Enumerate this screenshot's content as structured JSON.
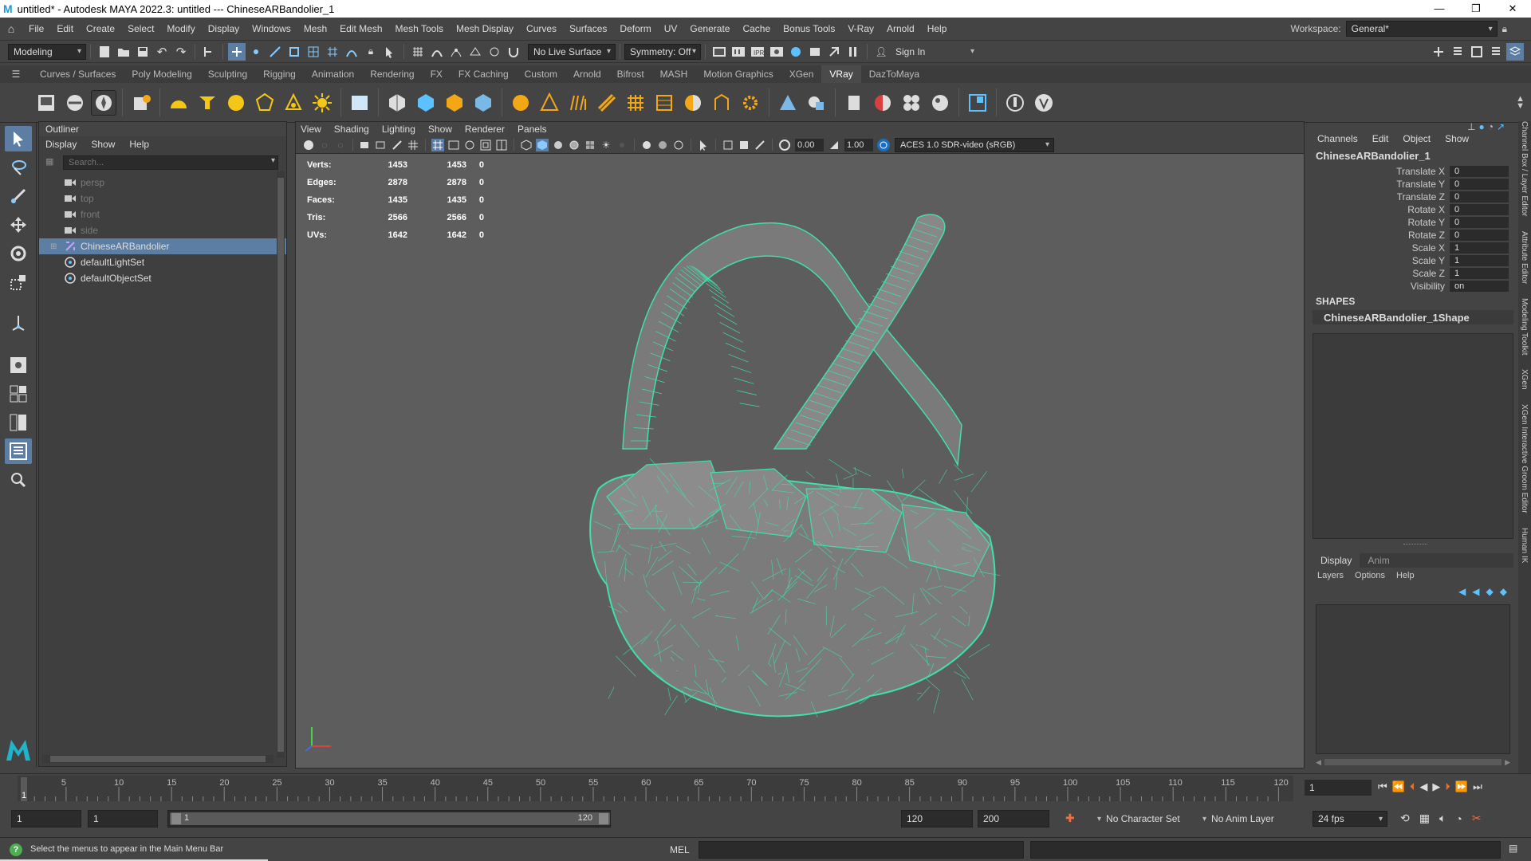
{
  "window": {
    "title": "untitled* - Autodesk MAYA 2022.3: untitled   ---   ChineseARBandolier_1",
    "minimize": "—",
    "restore": "❐",
    "close": "✕"
  },
  "menubar": {
    "items": [
      "File",
      "Edit",
      "Create",
      "Select",
      "Modify",
      "Display",
      "Windows",
      "Mesh",
      "Edit Mesh",
      "Mesh Tools",
      "Mesh Display",
      "Curves",
      "Surfaces",
      "Deform",
      "UV",
      "Generate",
      "Cache",
      "Bonus Tools",
      "V-Ray",
      "Arnold",
      "Help"
    ],
    "workspace_label": "Workspace:",
    "workspace_value": "General*"
  },
  "statusline": {
    "menuset": "Modeling",
    "live_surface": "No Live Surface",
    "symmetry": "Symmetry: Off",
    "sign_in": "Sign In"
  },
  "shelf": {
    "tabs": [
      "Curves / Surfaces",
      "Poly Modeling",
      "Sculpting",
      "Rigging",
      "Animation",
      "Rendering",
      "FX",
      "FX Caching",
      "Custom",
      "Arnold",
      "Bifrost",
      "MASH",
      "Motion Graphics",
      "XGen",
      "VRay",
      "DazToMaya"
    ],
    "active_tab": "VRay"
  },
  "outliner": {
    "title": "Outliner",
    "menu": [
      "Display",
      "Show",
      "Help"
    ],
    "search_placeholder": "Search...",
    "items": [
      {
        "label": "persp",
        "type": "camera",
        "dim": true
      },
      {
        "label": "top",
        "type": "camera",
        "dim": true
      },
      {
        "label": "front",
        "type": "camera",
        "dim": true
      },
      {
        "label": "side",
        "type": "camera",
        "dim": true
      },
      {
        "label": "ChineseARBandolier",
        "type": "mesh",
        "dim": false,
        "selected": true
      },
      {
        "label": "defaultLightSet",
        "type": "set",
        "dim": false
      },
      {
        "label": "defaultObjectSet",
        "type": "set",
        "dim": false
      }
    ]
  },
  "viewport": {
    "menu": [
      "View",
      "Shading",
      "Lighting",
      "Show",
      "Renderer",
      "Panels"
    ],
    "exposure": "0.00",
    "gamma": "1.00",
    "color_space": "ACES 1.0 SDR-video (sRGB)",
    "hud": [
      {
        "label": "Verts:",
        "a": "1453",
        "b": "1453",
        "c": "0"
      },
      {
        "label": "Edges:",
        "a": "2878",
        "b": "2878",
        "c": "0"
      },
      {
        "label": "Faces:",
        "a": "1435",
        "b": "1435",
        "c": "0"
      },
      {
        "label": "Tris:",
        "a": "2566",
        "b": "2566",
        "c": "0"
      },
      {
        "label": "UVs:",
        "a": "1642",
        "b": "1642",
        "c": "0"
      }
    ],
    "wire_color": "#40e0a8"
  },
  "channelbox": {
    "menu": [
      "Channels",
      "Edit",
      "Object",
      "Show"
    ],
    "object": "ChineseARBandolier_1",
    "attributes": [
      {
        "name": "Translate X",
        "value": "0"
      },
      {
        "name": "Translate Y",
        "value": "0"
      },
      {
        "name": "Translate Z",
        "value": "0"
      },
      {
        "name": "Rotate X",
        "value": "0"
      },
      {
        "name": "Rotate Y",
        "value": "0"
      },
      {
        "name": "Rotate Z",
        "value": "0"
      },
      {
        "name": "Scale X",
        "value": "1"
      },
      {
        "name": "Scale Y",
        "value": "1"
      },
      {
        "name": "Scale Z",
        "value": "1"
      },
      {
        "name": "Visibility",
        "value": "on"
      }
    ],
    "shapes_label": "SHAPES",
    "shape_name": "ChineseARBandolier_1Shape"
  },
  "layer_editor": {
    "tabs": [
      "Display",
      "Anim"
    ],
    "menu": [
      "Layers",
      "Options",
      "Help"
    ]
  },
  "side_tabs": [
    "Channel Box / Layer Editor",
    "Attribute Editor",
    "Modeling Toolkit",
    "XGen",
    "XGen Interactive Groom Editor",
    "Human IK"
  ],
  "timeline": {
    "ticks": [
      "5",
      "10",
      "15",
      "20",
      "25",
      "30",
      "35",
      "40",
      "45",
      "50",
      "55",
      "60",
      "65",
      "70",
      "75",
      "80",
      "85",
      "90",
      "95",
      "100",
      "105",
      "110",
      "115",
      "120"
    ],
    "current_frame": "1",
    "start_marker": "1"
  },
  "range": {
    "start": "1",
    "playback_start": "1",
    "range_start_label": "1",
    "range_end_label": "120",
    "playback_end": "120",
    "end": "200",
    "character_set": "No Character Set",
    "anim_layer": "No Anim Layer",
    "fps": "24 fps"
  },
  "commandline": {
    "help_text": "Select the menus to appear in the Main Menu Bar",
    "lang": "MEL"
  }
}
